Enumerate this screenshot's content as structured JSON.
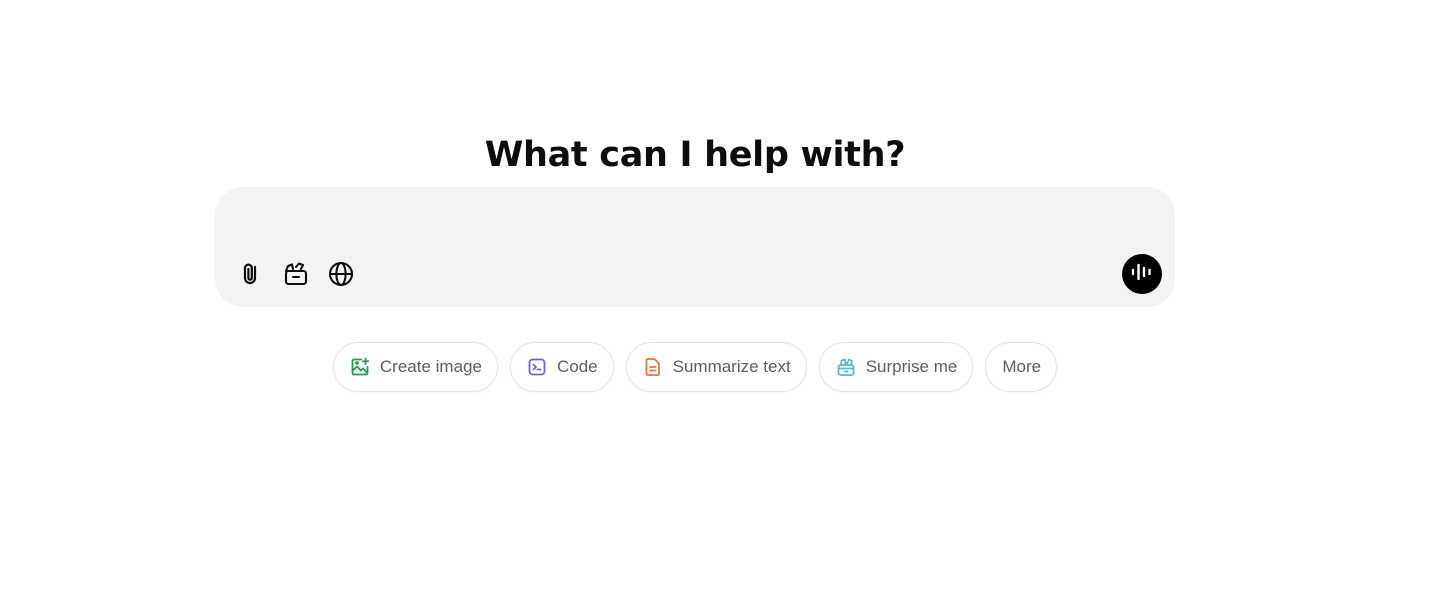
{
  "heading": "What can I help with?",
  "composer": {
    "placeholder": "",
    "tools": [
      {
        "icon": "paperclip-icon"
      },
      {
        "icon": "clapperboard-icon"
      },
      {
        "icon": "globe-icon"
      }
    ],
    "voice_icon": "voice-waveform-icon"
  },
  "chips": [
    {
      "label": "Create image",
      "icon": "create-image-icon",
      "color": "#1e9b4a"
    },
    {
      "label": "Code",
      "icon": "code-terminal-icon",
      "color": "#6b62e8"
    },
    {
      "label": "Summarize text",
      "icon": "document-icon",
      "color": "#e8763b"
    },
    {
      "label": "Surprise me",
      "icon": "gift-icon",
      "color": "#56b8d6"
    },
    {
      "label": "More",
      "icon": "",
      "color": ""
    }
  ]
}
